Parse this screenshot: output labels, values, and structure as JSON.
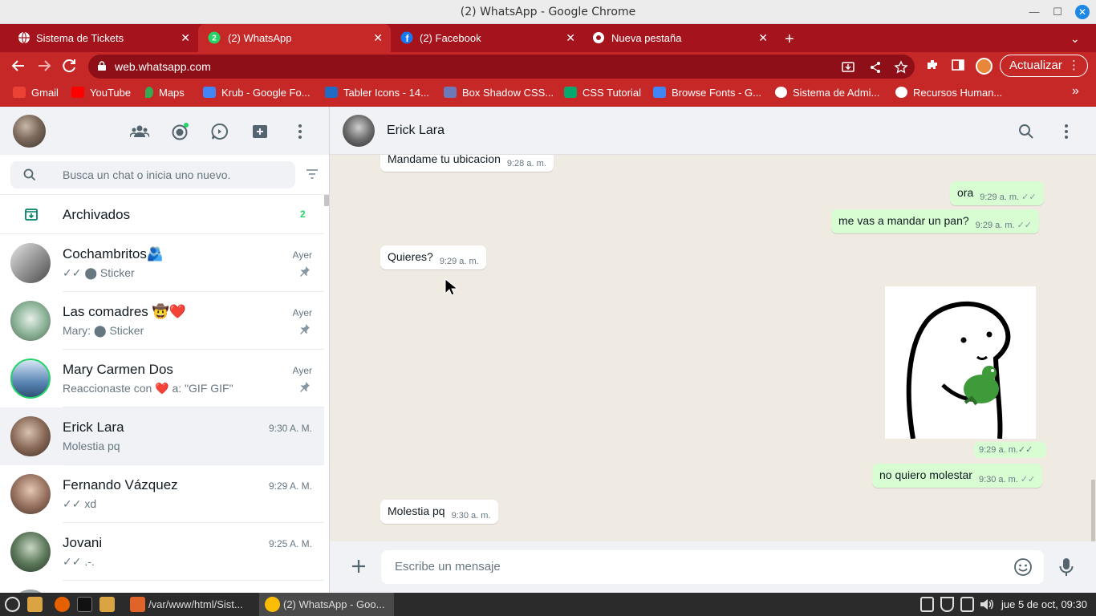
{
  "window": {
    "title": "(2) WhatsApp - Google Chrome",
    "minimize": "—",
    "maximize": "☐",
    "close": "✕"
  },
  "tabs": [
    {
      "label": "Sistema de Tickets",
      "icon": "globe-icon"
    },
    {
      "label": "(2) WhatsApp",
      "icon": "whatsapp-icon",
      "badge": "2"
    },
    {
      "label": "(2) Facebook",
      "icon": "facebook-icon"
    },
    {
      "label": "Nueva pestaña",
      "icon": "chrome-icon"
    }
  ],
  "tab_close": "✕",
  "new_tab": "+",
  "tab_menu": "⌄",
  "address_bar": {
    "url": "web.whatsapp.com",
    "update_label": "Actualizar"
  },
  "bookmarks": [
    {
      "label": "Gmail",
      "color": "#ea4335"
    },
    {
      "label": "YouTube",
      "color": "#ff0000"
    },
    {
      "label": "Maps",
      "color": "#34a853"
    },
    {
      "label": "Krub - Google Fo...",
      "color": "#4285f4"
    },
    {
      "label": "Tabler Icons - 14...",
      "color": "#206bc4"
    },
    {
      "label": "Box Shadow CSS...",
      "color": "#6c7ab8"
    },
    {
      "label": "CSS Tutorial",
      "color": "#04aa6d"
    },
    {
      "label": "Browse Fonts - G...",
      "color": "#4285f4"
    },
    {
      "label": "Sistema de Admi...",
      "color": "#ffffff"
    },
    {
      "label": "Recursos Human...",
      "color": "#ffffff"
    }
  ],
  "bookmarks_more": "»",
  "sidebar": {
    "search_placeholder": "Busca un chat o inicia uno nuevo.",
    "archived_label": "Archivados",
    "archived_count": "2",
    "chats": [
      {
        "name": "Cochambritos🫂",
        "time": "Ayer",
        "message": "✓✓ ⬤ Sticker",
        "pinned": true
      },
      {
        "name": "Las comadres 🤠❤️",
        "time": "Ayer",
        "message": "Mary: ⬤ Sticker",
        "pinned": true
      },
      {
        "name": "Mary Carmen Dos",
        "time": "Ayer",
        "message": "Reaccionaste con ❤️ a: \"GIF GIF\"",
        "pinned": true
      },
      {
        "name": "Erick Lara",
        "time": "9:30 A. M.",
        "message": "Molestia pq",
        "pinned": false
      },
      {
        "name": "Fernando Vázquez",
        "time": "9:29 A. M.",
        "message": "✓✓ xd",
        "pinned": false
      },
      {
        "name": "Jovani",
        "time": "9:25 A. M.",
        "message": "✓✓ .-.",
        "pinned": false
      }
    ]
  },
  "conversation": {
    "contact_name": "Erick Lara",
    "messages": [
      {
        "direction": "in",
        "text": "Mandame tu ubicacion",
        "time": "9:28 a. m."
      },
      {
        "direction": "out",
        "text": "ora",
        "time": "9:29 a. m."
      },
      {
        "direction": "out",
        "text": "me vas  a mandar un pan?",
        "time": "9:29 a. m."
      },
      {
        "direction": "in",
        "text": "Quieres?",
        "time": "9:29 a. m."
      },
      {
        "direction": "out",
        "text": "",
        "time": "9:29 a. m.",
        "sticker": true
      },
      {
        "direction": "out",
        "text": "no quiero molestar",
        "time": "9:30 a. m."
      },
      {
        "direction": "in",
        "text": "Molestia pq",
        "time": "9:30 a. m."
      }
    ],
    "input_placeholder": "Escribe un mensaje",
    "read_ticks": "✓✓"
  },
  "taskbar": {
    "items": [
      {
        "label": "/var/www/html/Sist..."
      },
      {
        "label": "(2) WhatsApp - Goo..."
      }
    ],
    "clock": "jue  5 de oct, 09:30"
  },
  "colors": {
    "chrome_theme": "#c62828",
    "whatsapp_green": "#25d366",
    "outgoing_bubble": "#d9fdd3"
  }
}
